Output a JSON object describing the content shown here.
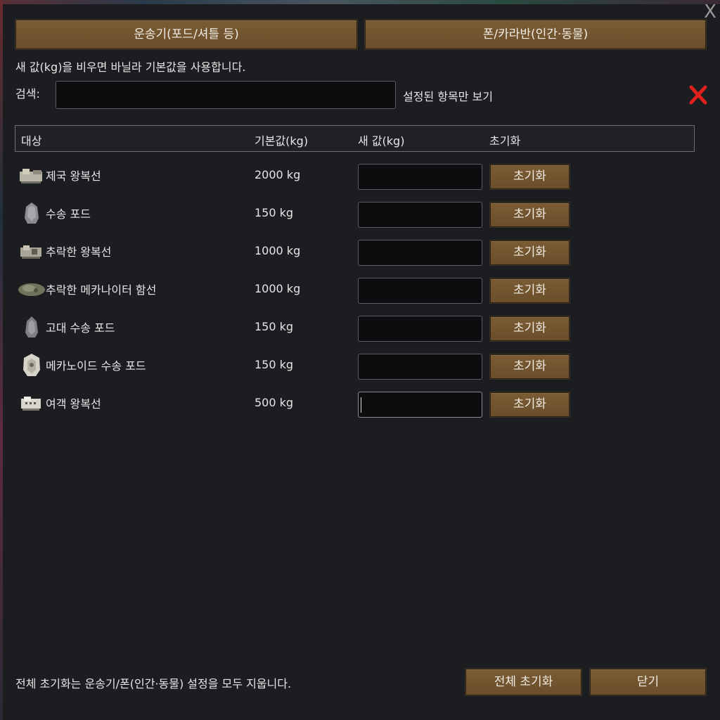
{
  "window": {
    "close_symbol": "X"
  },
  "tabs": [
    {
      "label": "운송기(포드/셔틀 등)"
    },
    {
      "label": "폰/카라반(인간·동물)"
    }
  ],
  "hint": "새 값(kg)을 비우면 바닐라 기본값을 사용합니다.",
  "search": {
    "label": "검색:",
    "value": "",
    "filter_label": "설정된 항목만 보기",
    "filter_icon": "red-x-icon"
  },
  "table": {
    "headers": [
      "대상",
      "기본값(kg)",
      "새 값(kg)",
      "초기화"
    ],
    "rows": [
      {
        "name": "제국 왕복선",
        "default": "2000 kg",
        "new_value": "",
        "reset_label": "초기화",
        "icon": "imperial-shuttle-icon"
      },
      {
        "name": "수송 포드",
        "default": "150 kg",
        "new_value": "",
        "reset_label": "초기화",
        "icon": "transport-pod-icon"
      },
      {
        "name": "추락한 왕복선",
        "default": "1000 kg",
        "new_value": "",
        "reset_label": "초기화",
        "icon": "crashed-shuttle-icon"
      },
      {
        "name": "추락한 메카나이터 함선",
        "default": "1000 kg",
        "new_value": "",
        "reset_label": "초기화",
        "icon": "crashed-mechanitor-ship-icon"
      },
      {
        "name": "고대 수송 포드",
        "default": "150 kg",
        "new_value": "",
        "reset_label": "초기화",
        "icon": "ancient-transport-pod-icon"
      },
      {
        "name": "메카노이드 수송 포드",
        "default": "150 kg",
        "new_value": "",
        "reset_label": "초기화",
        "icon": "mechanoid-transport-pod-icon"
      },
      {
        "name": "여객 왕복선",
        "default": "500 kg",
        "new_value": "",
        "reset_label": "초기화",
        "icon": "passenger-shuttle-icon"
      }
    ]
  },
  "footer": {
    "note": "전체 초기화는 운송기/폰(인간·동물) 설정을 모두 지웁니다.",
    "reset_all_label": "전체 초기화",
    "close_label": "닫기"
  },
  "colors": {
    "button": "#6f522d",
    "background": "#1b1d21",
    "input": "#0c0d0f",
    "accent_red": "#e0201c"
  }
}
